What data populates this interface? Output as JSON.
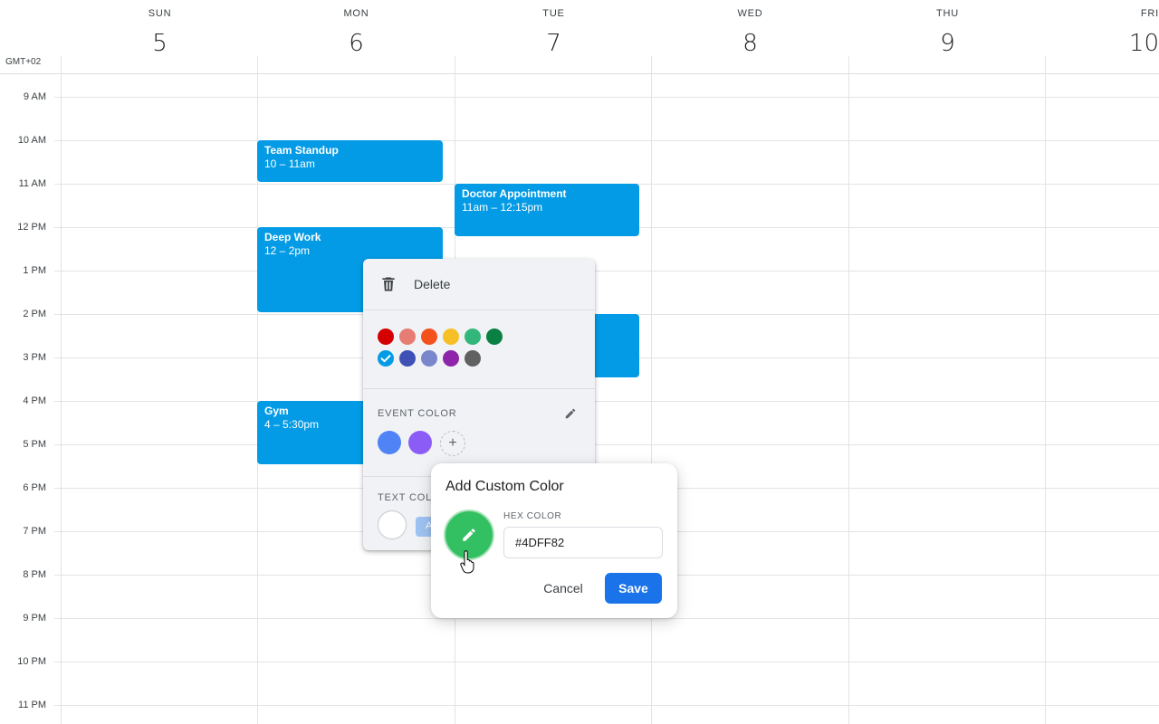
{
  "timezone": "GMT+02",
  "days": [
    {
      "name": "SUN",
      "num": "5"
    },
    {
      "name": "MON",
      "num": "6"
    },
    {
      "name": "TUE",
      "num": "7"
    },
    {
      "name": "WED",
      "num": "8"
    },
    {
      "name": "THU",
      "num": "9"
    },
    {
      "name": "FRI",
      "num": "10"
    }
  ],
  "hours": [
    "9 AM",
    "10 AM",
    "11 AM",
    "12 PM",
    "1 PM",
    "2 PM",
    "3 PM",
    "4 PM",
    "5 PM",
    "6 PM",
    "7 PM",
    "8 PM",
    "9 PM",
    "10 PM",
    "11 PM"
  ],
  "events": [
    {
      "title": "Team Standup",
      "time": "10 – 11am",
      "color": "#039be5"
    },
    {
      "title": "Doctor Appointment",
      "time": "11am – 12:15pm",
      "color": "#039be5"
    },
    {
      "title": "Deep Work",
      "time": "12 – 2pm",
      "color": "#039be5"
    },
    {
      "title": "Gym",
      "time": "4 – 5:30pm",
      "color": "#039be5"
    }
  ],
  "menu": {
    "delete_label": "Delete",
    "palette": [
      "#d50000",
      "#e67c73",
      "#f4511e",
      "#f6bf26",
      "#33b679",
      "#0b8043",
      "#039be5",
      "#3f51b5",
      "#7986cb",
      "#8e24aa",
      "#616161"
    ],
    "selected_color": "#039be5",
    "event_color_label": "EVENT COLOR",
    "event_custom_colors": [
      "#4f83f6",
      "#8b5cf6"
    ],
    "add_symbol": "+",
    "text_color_label": "TEXT COLOR",
    "text_color_chip": "A"
  },
  "dialog": {
    "title": "Add Custom Color",
    "hex_label": "HEX COLOR",
    "hex_value": "#4DFF82",
    "preview_color": "#33c062",
    "cancel_label": "Cancel",
    "save_label": "Save"
  }
}
